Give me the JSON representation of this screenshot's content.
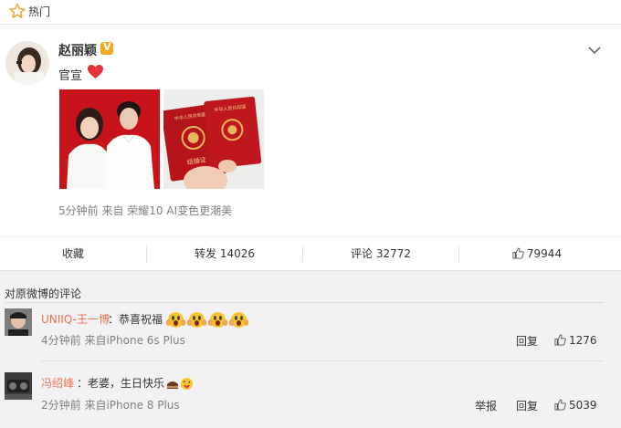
{
  "hot_bar": {
    "label": "热门",
    "icon": "star-icon"
  },
  "post": {
    "author": "赵丽颖",
    "verified_badge": "V",
    "text": "官宣",
    "images": [
      "couple-photo",
      "marriage-certificate-photo"
    ],
    "certificate_text": "中华人民共和国",
    "certificate_title": "结婚证",
    "meta": "5分钟前 来自 荣耀10 AI变色更潮美"
  },
  "actions": {
    "favorite": "收藏",
    "repost": "转发 14026",
    "comment": "评论 32772",
    "likes": "79944"
  },
  "comments_section_title": "对原微博的评论",
  "comments": [
    {
      "author": "UNIIQ-王一博",
      "text": "：恭喜祝福",
      "emoji_count": 4,
      "meta": "4分钟前 来自iPhone 6s Plus",
      "reply": "回复",
      "likes": "1276"
    },
    {
      "author": "冯绍峰",
      "text": "：老婆，生日快乐",
      "meta": "2分钟前 来自iPhone 8 Plus",
      "report": "举报",
      "reply": "回复",
      "likes": "5039"
    }
  ],
  "colors": {
    "name_link": "#eb7350",
    "heart": "#e8323a",
    "red_bg": "#c8131a",
    "badge": "#f6a623"
  }
}
